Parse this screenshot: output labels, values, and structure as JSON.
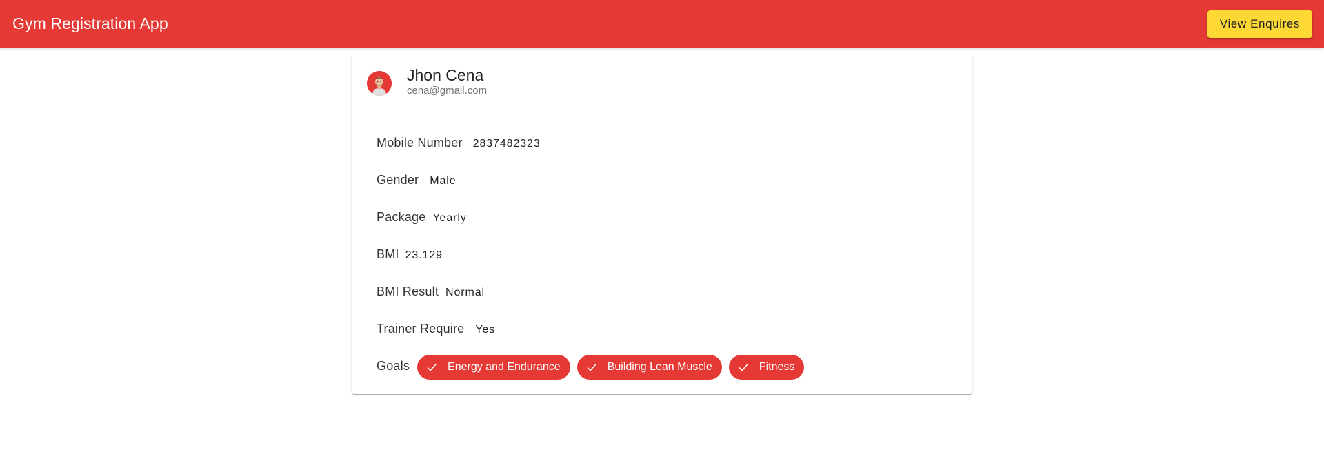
{
  "toolbar": {
    "title": "Gym Registration App",
    "view_enquires_label": "View Enquires"
  },
  "colors": {
    "primary": "#e53935",
    "accent": "#fdd835"
  },
  "profile": {
    "avatar_icon": "user-avatar-icon",
    "name": "Jhon Cena",
    "email": "cena@gmail.com"
  },
  "details": {
    "mobile": {
      "label": "Mobile Number",
      "value": "2837482323"
    },
    "gender": {
      "label": "Gender",
      "value": "Male"
    },
    "package": {
      "label": "Package",
      "value": "Yearly"
    },
    "bmi": {
      "label": "BMI",
      "value": "23.129"
    },
    "bmi_result": {
      "label": "BMI Result",
      "value": "Normal"
    },
    "trainer": {
      "label": "Trainer Require",
      "value": "Yes"
    }
  },
  "goals": {
    "label": "Goals",
    "check_icon": "check-icon",
    "items": [
      "Energy and Endurance",
      "Building Lean Muscle",
      "Fitness"
    ]
  }
}
